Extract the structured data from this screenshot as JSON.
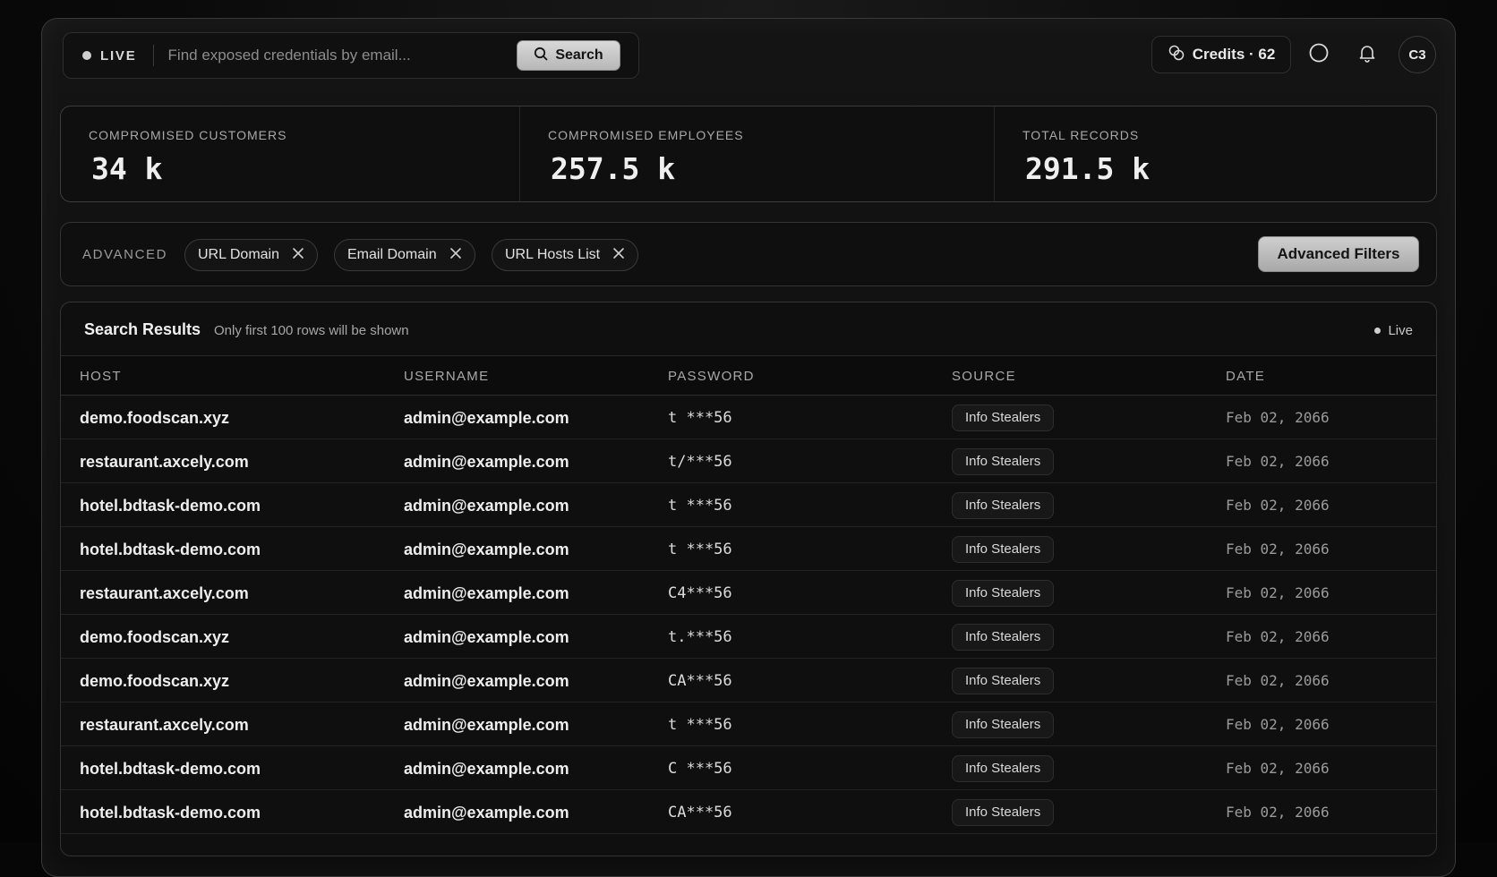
{
  "topbar": {
    "live_label": "LIVE",
    "search_placeholder": "Find exposed credentials by email...",
    "search_button": "Search",
    "credits_label": "Credits · 62",
    "avatar_initials": "C3"
  },
  "stats": [
    {
      "label": "COMPROMISED CUSTOMERS",
      "value": "34 k"
    },
    {
      "label": "COMPROMISED EMPLOYEES",
      "value": "257.5 k"
    },
    {
      "label": "TOTAL RECORDS",
      "value": "291.5 k"
    }
  ],
  "filters": {
    "section_label": "ADVANCED",
    "chips": [
      "URL Domain",
      "Email Domain",
      "URL Hosts List"
    ],
    "advanced_button": "Advanced Filters"
  },
  "results": {
    "title": "Search Results",
    "subtitle": "Only first 100 rows will be shown",
    "live_label": "Live",
    "columns": [
      "HOST",
      "USERNAME",
      "PASSWORD",
      "SOURCE",
      "DATE"
    ],
    "rows": [
      {
        "host": "demo.foodscan.xyz",
        "username": "admin@example.com",
        "password": "t ***56",
        "source": "Info Stealers",
        "date": "Feb 02, 2066"
      },
      {
        "host": "restaurant.axcely.com",
        "username": "admin@example.com",
        "password": "t/***56",
        "source": "Info Stealers",
        "date": "Feb 02, 2066"
      },
      {
        "host": "hotel.bdtask-demo.com",
        "username": "admin@example.com",
        "password": "t ***56",
        "source": "Info Stealers",
        "date": "Feb 02, 2066"
      },
      {
        "host": "hotel.bdtask-demo.com",
        "username": "admin@example.com",
        "password": "t ***56",
        "source": "Info Stealers",
        "date": "Feb 02, 2066"
      },
      {
        "host": "restaurant.axcely.com",
        "username": "admin@example.com",
        "password": "C4***56",
        "source": "Info Stealers",
        "date": "Feb 02, 2066"
      },
      {
        "host": "demo.foodscan.xyz",
        "username": "admin@example.com",
        "password": "t.***56",
        "source": "Info Stealers",
        "date": "Feb 02, 2066"
      },
      {
        "host": "demo.foodscan.xyz",
        "username": "admin@example.com",
        "password": "CA***56",
        "source": "Info Stealers",
        "date": "Feb 02, 2066"
      },
      {
        "host": "restaurant.axcely.com",
        "username": "admin@example.com",
        "password": "t ***56",
        "source": "Info Stealers",
        "date": "Feb 02, 2066"
      },
      {
        "host": "hotel.bdtask-demo.com",
        "username": "admin@example.com",
        "password": "C ***56",
        "source": "Info Stealers",
        "date": "Feb 02, 2066"
      },
      {
        "host": "hotel.bdtask-demo.com",
        "username": "admin@example.com",
        "password": "CA***56",
        "source": "Info Stealers",
        "date": "Feb 02, 2066"
      }
    ]
  },
  "icons": {
    "search": "search-icon",
    "credits": "coins-icon",
    "theme": "circle-icon",
    "notifications": "bell-icon",
    "chip_remove": "close-icon"
  }
}
